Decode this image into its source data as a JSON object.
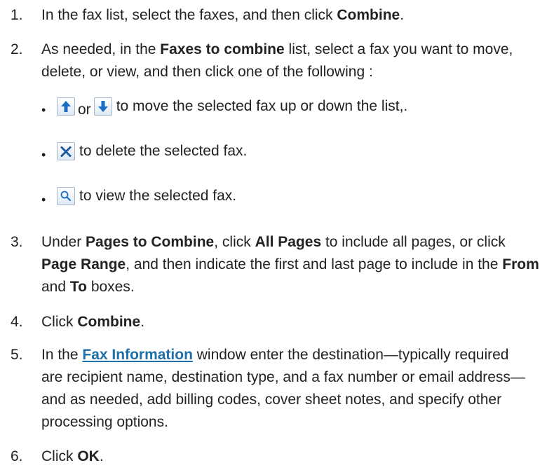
{
  "steps": [
    {
      "num": "1.",
      "a": "In the fax list, select the faxes, and then click ",
      "b": "Combine",
      "c": "."
    },
    {
      "num": "2.",
      "a": "As needed, in the ",
      "b": "Faxes to combine",
      "c": " list, select a fax you want to move, delete, or view, and then click one of the following :"
    },
    {
      "num": "3.",
      "a": "Under ",
      "b": "Pages to Combine",
      "c": ", click ",
      "d": "All Pages",
      "e": " to include all pages, or click ",
      "f": "Page Range",
      "g": ", and then indicate the first and last page to include in the ",
      "h": "From",
      "i": " and ",
      "j": "To",
      "k": " boxes."
    },
    {
      "num": "4.",
      "a": "Click ",
      "b": "Combine",
      "c": "."
    },
    {
      "num": "5.",
      "a": "In the ",
      "link": "Fax Information",
      "c": " window enter the destination—typically required are recipient name, destination type, and a fax number or email address—and as needed, add billing codes, cover sheet notes, and specify other processing options."
    },
    {
      "num": "6.",
      "a": "Click ",
      "b": "OK",
      "c": "."
    }
  ],
  "bullets": {
    "move": {
      "or": "or",
      "text": "to move the selected fax up or down the list,."
    },
    "delete": {
      "text": "to delete the selected fax."
    },
    "view": {
      "text": "to view the selected fax."
    }
  },
  "icons": {
    "up": "arrow-up-icon",
    "down": "arrow-down-icon",
    "delete": "delete-x-icon",
    "view": "magnifier-icon"
  },
  "colors": {
    "text": "#222222",
    "link": "#1f6fa8",
    "icon_blue": "#1a6fc4"
  }
}
